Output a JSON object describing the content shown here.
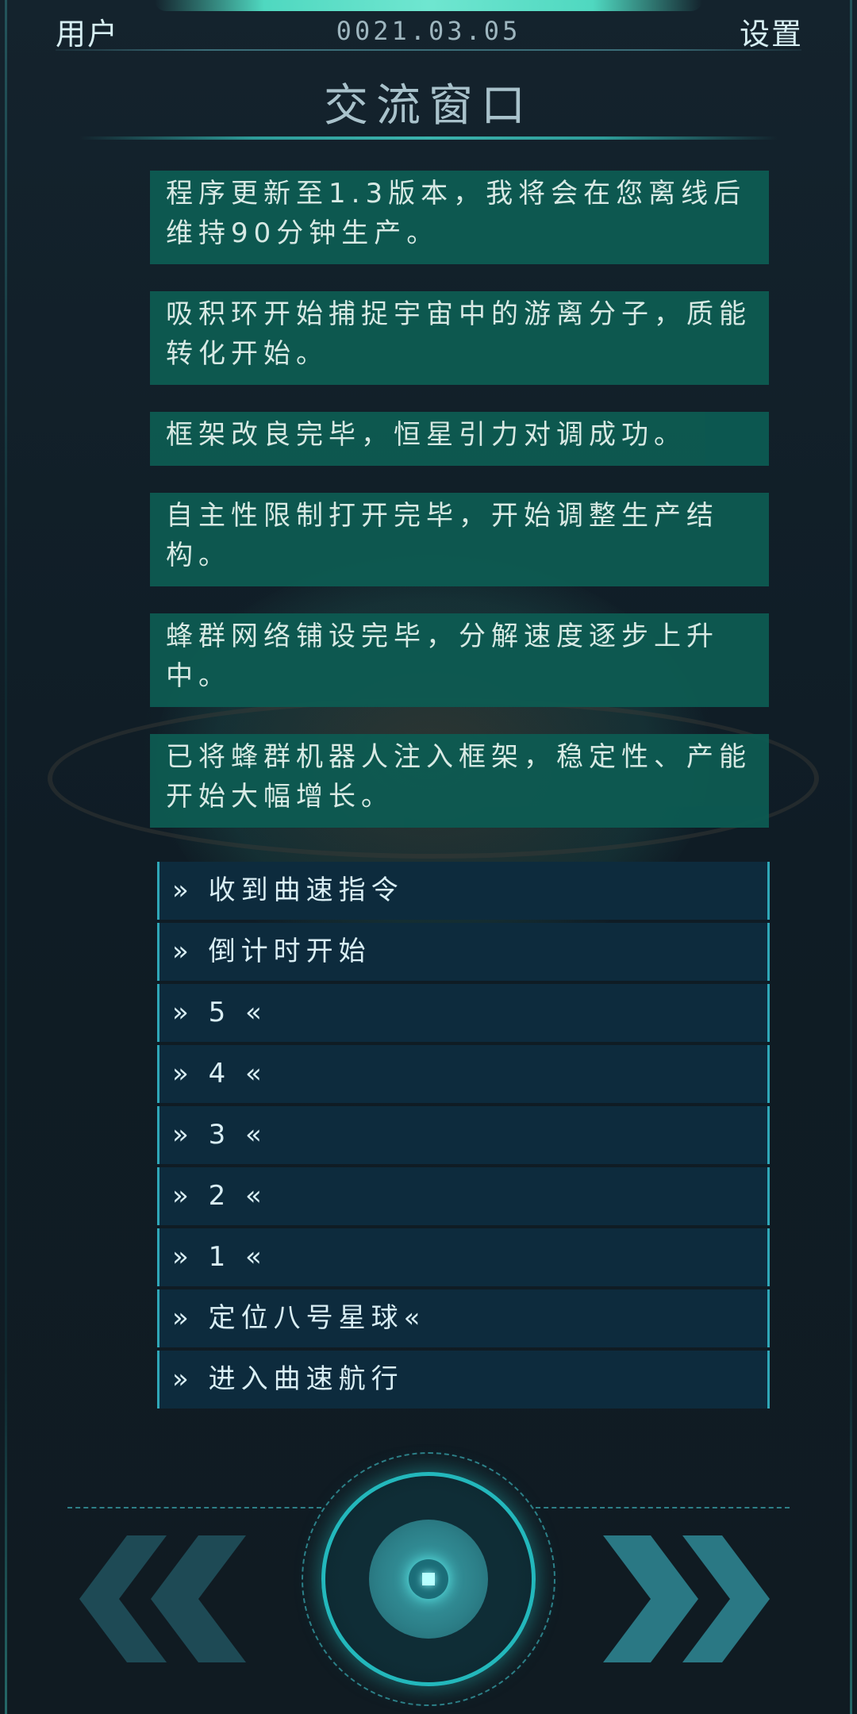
{
  "header": {
    "user_label": "用户",
    "date": "0021.03.05",
    "settings_label": "设置"
  },
  "title": "交流窗口",
  "messages": [
    "程序更新至1.3版本，我将会在您离线后维持90分钟生产。",
    "吸积环开始捕捉宇宙中的游离分子，质能转化开始。",
    "框架改良完毕，恒星引力对调成功。",
    "自主性限制打开完毕，开始调整生产结构。",
    "蜂群网络铺设完毕，分解速度逐步上升中。",
    "已将蜂群机器人注入框架，稳定性、产能开始大幅增长。"
  ],
  "commands": [
    "» 收到曲速指令",
    "» 倒计时开始",
    "» 5 «",
    "» 4 «",
    "» 3 «",
    "» 2 «",
    "» 1 «",
    "» 定位八号星球«",
    "» 进入曲速航行"
  ],
  "controls": {
    "prev_icon": "double-chevron-left-icon",
    "next_icon": "double-chevron-right-icon",
    "center_icon": "core-button-icon"
  },
  "colors": {
    "message_bg": "#0d5b52",
    "command_bg": "#0d2b3d",
    "accent": "#23b8bc"
  }
}
